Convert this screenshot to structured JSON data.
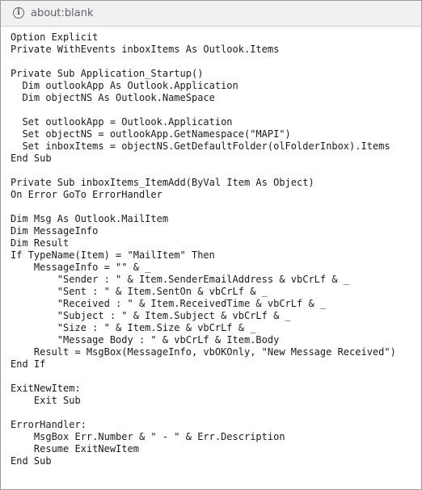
{
  "address_bar": {
    "icon": "info-icon",
    "url": "about:blank"
  },
  "code_lines": [
    "Option Explicit",
    "Private WithEvents inboxItems As Outlook.Items",
    "",
    "Private Sub Application_Startup()",
    "  Dim outlookApp As Outlook.Application",
    "  Dim objectNS As Outlook.NameSpace",
    "",
    "  Set outlookApp = Outlook.Application",
    "  Set objectNS = outlookApp.GetNamespace(\"MAPI\")",
    "  Set inboxItems = objectNS.GetDefaultFolder(olFolderInbox).Items",
    "End Sub",
    "",
    "Private Sub inboxItems_ItemAdd(ByVal Item As Object)",
    "On Error GoTo ErrorHandler",
    "",
    "Dim Msg As Outlook.MailItem",
    "Dim MessageInfo",
    "Dim Result",
    "If TypeName(Item) = \"MailItem\" Then",
    "    MessageInfo = \"\" & _",
    "        \"Sender : \" & Item.SenderEmailAddress & vbCrLf & _",
    "        \"Sent : \" & Item.SentOn & vbCrLf & _",
    "        \"Received : \" & Item.ReceivedTime & vbCrLf & _",
    "        \"Subject : \" & Item.Subject & vbCrLf & _",
    "        \"Size : \" & Item.Size & vbCrLf & _",
    "        \"Message Body : \" & vbCrLf & Item.Body",
    "    Result = MsgBox(MessageInfo, vbOKOnly, \"New Message Received\")",
    "End If",
    "",
    "ExitNewItem:",
    "    Exit Sub",
    "",
    "ErrorHandler:",
    "    MsgBox Err.Number & \" - \" & Err.Description",
    "    Resume ExitNewItem",
    "End Sub"
  ]
}
